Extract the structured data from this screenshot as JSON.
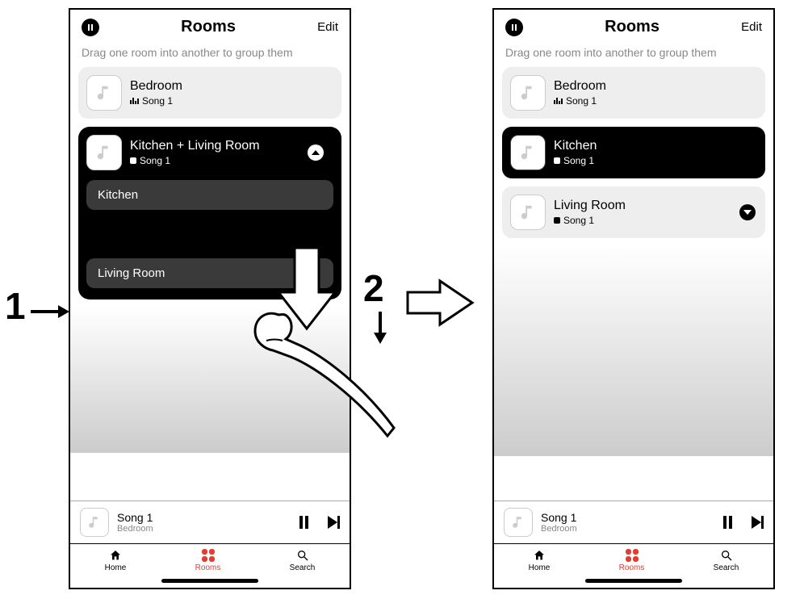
{
  "annotations": {
    "step1": "1",
    "step2": "2"
  },
  "colors": {
    "accent": "#e63b2e"
  },
  "left": {
    "header": {
      "title": "Rooms",
      "edit": "Edit"
    },
    "hint": "Drag one room into another to group them",
    "rooms": [
      {
        "name": "Bedroom",
        "track": "Song 1",
        "state": "playing"
      }
    ],
    "group": {
      "name": "Kitchen + Living Room",
      "track": "Song 1",
      "subrooms": [
        "Kitchen",
        "Living Room"
      ]
    },
    "nowplaying": {
      "title": "Song 1",
      "room": "Bedroom"
    },
    "tabs": {
      "home": "Home",
      "rooms": "Rooms",
      "search": "Search",
      "active": "rooms"
    }
  },
  "right": {
    "header": {
      "title": "Rooms",
      "edit": "Edit"
    },
    "hint": "Drag one room into another to group them",
    "rooms": [
      {
        "name": "Bedroom",
        "track": "Song 1",
        "state": "playing",
        "style": "light"
      },
      {
        "name": "Kitchen",
        "track": "Song 1",
        "state": "stopped",
        "style": "dark"
      },
      {
        "name": "Living Room",
        "track": "Song 1",
        "state": "stopped",
        "style": "light",
        "expandable": true
      }
    ],
    "nowplaying": {
      "title": "Song 1",
      "room": "Bedroom"
    },
    "tabs": {
      "home": "Home",
      "rooms": "Rooms",
      "search": "Search",
      "active": "rooms"
    }
  }
}
